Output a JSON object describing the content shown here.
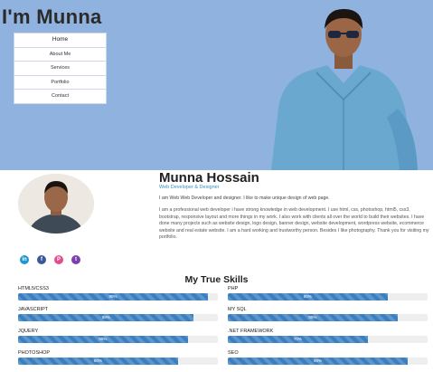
{
  "hero": {
    "title": "I'm Munna",
    "menu": [
      "Home",
      "About Me",
      "Services",
      "Portfolio",
      "Contact"
    ]
  },
  "profile": {
    "name": "Munna Hossain",
    "role": "Web Developer & Designer",
    "tagline": "I am Web Web Developer and designer. I like to make unique design of web page.",
    "bio": "I am a professional web developer i have strong knowledge in web development. I use html, css, photoshop, html5, css3, bootstrap, responsive layout and more things in my work. I also work with clients all over the world to build their websites. I have done many projects such as website design, logo design, banner design, website development, wordpress website, ecommerce website and real estate website. I am a hard working and trustworthy person. Besides I like photography. Thank you for visiting my portfolio.",
    "social": [
      {
        "label": "in",
        "icon": "linkedin-icon",
        "color": "#2196c9"
      },
      {
        "label": "f",
        "icon": "facebook-icon",
        "color": "#3b5998"
      },
      {
        "label": "P",
        "icon": "pinterest-icon",
        "color": "#e04f8c"
      },
      {
        "label": "t",
        "icon": "twitter-icon",
        "color": "#7b3fb0"
      }
    ]
  },
  "skills": {
    "title": "My True Skills",
    "items": [
      {
        "name": "HTML5/CSS3",
        "percent": 95,
        "label": "95%"
      },
      {
        "name": "PHP",
        "percent": 80,
        "label": "80%"
      },
      {
        "name": "JAVASCRIPT",
        "percent": 88,
        "label": "88%"
      },
      {
        "name": "MY SQL",
        "percent": 85,
        "label": "85%"
      },
      {
        "name": "JQUERY",
        "percent": 85,
        "label": "85%"
      },
      {
        "name": ".NET FRAMEWORK",
        "percent": 70,
        "label": "70%"
      },
      {
        "name": "PHOTOSHOP",
        "percent": 80,
        "label": "80%"
      },
      {
        "name": "SEO",
        "percent": 90,
        "label": "90%"
      }
    ]
  }
}
